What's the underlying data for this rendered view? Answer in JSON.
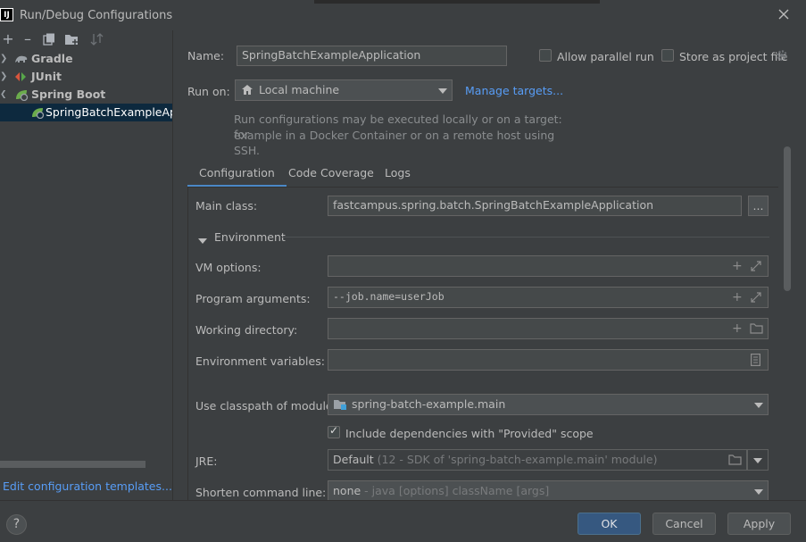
{
  "window": {
    "title": "Run/Debug Configurations",
    "logo_text": "IJ"
  },
  "sidebar": {
    "toolbar": [
      "add",
      "remove",
      "copy",
      "new-folder",
      "sort"
    ],
    "tree": [
      {
        "label": "Gradle",
        "expanded": false
      },
      {
        "label": "JUnit",
        "expanded": false
      },
      {
        "label": "Spring Boot",
        "expanded": true
      },
      {
        "label": "SpringBatchExampleApplic",
        "selected": true
      }
    ],
    "edit_templates_link": "Edit configuration templates..."
  },
  "form": {
    "name_label": "Name:",
    "name_value": "SpringBatchExampleApplication",
    "allow_parallel_label": "Allow parallel run",
    "allow_parallel_checked": false,
    "store_project_label": "Store as project file",
    "store_project_checked": false,
    "run_on_label": "Run on:",
    "run_on_value": "Local machine",
    "manage_targets": "Manage targets...",
    "run_on_hint_1": "Run configurations may be executed locally or on a target: for",
    "run_on_hint_2": "example in a Docker Container or on a remote host using SSH."
  },
  "tabs": [
    {
      "label": "Configuration",
      "active": true
    },
    {
      "label": "Code Coverage",
      "active": false
    },
    {
      "label": "Logs",
      "active": false
    }
  ],
  "config": {
    "main_class_label": "Main class:",
    "main_class_value": "fastcampus.spring.batch.SpringBatchExampleApplication",
    "browse_label": "...",
    "environment_label": "Environment",
    "vm_options_label": "VM options:",
    "vm_options_value": "",
    "program_args_label": "Program arguments:",
    "program_args_value": "--job.name=userJob",
    "working_dir_label": "Working directory:",
    "working_dir_value": "",
    "env_vars_label": "Environment variables:",
    "env_vars_value": "",
    "classpath_label": "Use classpath of module:",
    "classpath_value": "spring-batch-example.main",
    "include_deps_label": "Include dependencies with \"Provided\" scope",
    "include_deps_checked": true,
    "jre_label": "JRE:",
    "jre_value": "Default",
    "jre_hint": "(12 - SDK of 'spring-batch-example.main' module)",
    "shorten_label": "Shorten command line:",
    "shorten_value": "none",
    "shorten_hint": "- java [options] className [args]"
  },
  "footer": {
    "help": "?",
    "ok": "OK",
    "cancel": "Cancel",
    "apply": "Apply"
  },
  "colors": {
    "background": "#3c3f41",
    "field": "#45494a",
    "link": "#589df6",
    "selection": "#0d293e",
    "primary_button": "#365880",
    "tab_underline": "#4a88c7"
  }
}
